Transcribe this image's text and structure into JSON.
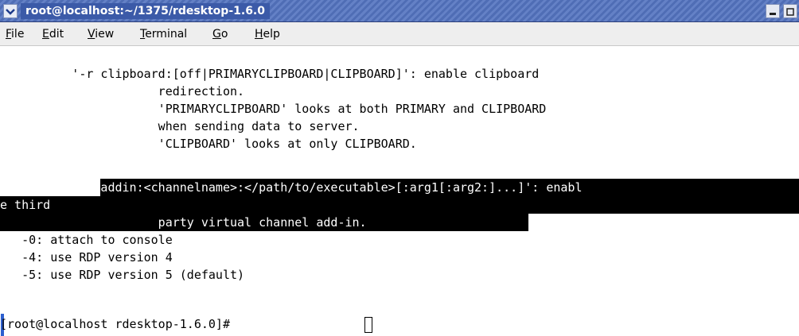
{
  "window": {
    "title": "root@localhost:~/1375/rdesktop-1.6.0",
    "menu_icon": "chevron-down-icon",
    "minimize_icon": "minimize-icon",
    "maximize_icon": "maximize-icon"
  },
  "menubar": {
    "items": [
      {
        "accel": "F",
        "rest": "ile"
      },
      {
        "accel": "E",
        "rest": "dit"
      },
      {
        "accel": "V",
        "rest": "iew"
      },
      {
        "accel": "T",
        "rest": "erminal"
      },
      {
        "accel": "G",
        "rest": "o"
      },
      {
        "accel": "H",
        "rest": "elp"
      }
    ]
  },
  "terminal": {
    "lines": [
      "          '-r clipboard:[off|PRIMARYCLIPBOARD|CLIPBOARD]': enable clipboard",
      "                      redirection.",
      "                      'PRIMARYCLIPBOARD' looks at both PRIMARY and CLIPBOARD",
      "                      when sending data to server.",
      "                      'CLIPBOARD' looks at only CLIPBOARD.",
      "          '-r addin:<channelname>:</path/to/executable>[:arg1[:arg2:]...]': enabl",
      "e third",
      "                      party virtual channel add-in.",
      "   -0: attach to console",
      "   -4: use RDP version 4",
      "   -5: use RDP version 5 (default)",
      "[root@localhost rdesktop-1.6.0]# "
    ]
  },
  "colors": {
    "titlebar": "#4f6db5",
    "selection": "#000000",
    "selection_text": "#ffffff"
  }
}
